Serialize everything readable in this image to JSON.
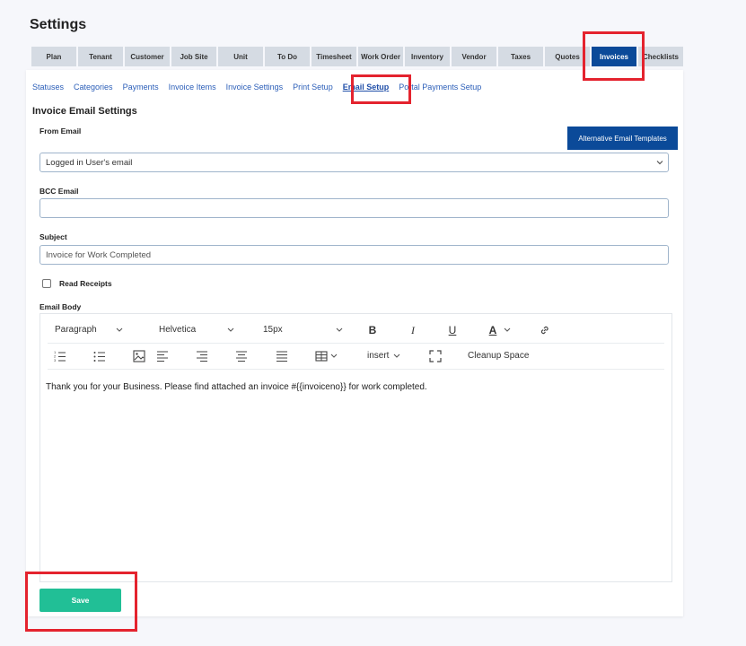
{
  "page": {
    "title": "Settings"
  },
  "main_tabs": [
    {
      "label": "Plan"
    },
    {
      "label": "Tenant"
    },
    {
      "label": "Customer"
    },
    {
      "label": "Job Site"
    },
    {
      "label": "Unit"
    },
    {
      "label": "To Do"
    },
    {
      "label": "Timesheet"
    },
    {
      "label": "Work Order"
    },
    {
      "label": "Inventory"
    },
    {
      "label": "Vendor"
    },
    {
      "label": "Taxes"
    },
    {
      "label": "Quotes"
    },
    {
      "label": "Invoices",
      "active": true
    },
    {
      "label": "Checklists"
    }
  ],
  "sub_tabs": [
    {
      "label": "Statuses"
    },
    {
      "label": "Categories"
    },
    {
      "label": "Payments"
    },
    {
      "label": "Invoice Items"
    },
    {
      "label": "Invoice Settings"
    },
    {
      "label": "Print Setup"
    },
    {
      "label": "Email Setup",
      "active": true
    },
    {
      "label": "Portal Payments Setup"
    }
  ],
  "section": {
    "title": "Invoice Email Settings"
  },
  "alt_templates_button": {
    "label": "Alternative Email Templates"
  },
  "from_email": {
    "label": "From Email",
    "value": "Logged in User's email"
  },
  "bcc_email": {
    "label": "BCC Email",
    "value": ""
  },
  "subject": {
    "label": "Subject",
    "value": "Invoice for Work Completed"
  },
  "read_receipts": {
    "label": "Read Receipts",
    "checked": false
  },
  "email_body": {
    "label": "Email Body",
    "toolbar": {
      "block_format": "Paragraph",
      "font_family": "Helvetica",
      "font_size": "15px",
      "insert_label": "insert",
      "cleanup_label": "Cleanup Space"
    },
    "content": "Thank you for your Business. Please find attached an invoice #{{invoiceno}} for work completed."
  },
  "save_button": {
    "label": "Save"
  },
  "colors": {
    "accent": "#0b4a99",
    "save": "#21bf96",
    "highlight": "#e4232e",
    "link": "#2b5eb8"
  }
}
